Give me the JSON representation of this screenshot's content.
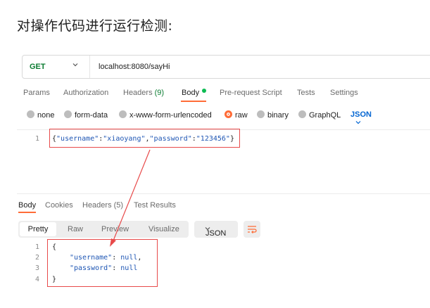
{
  "heading": "对操作代码进行运行检测:",
  "request": {
    "method": "GET",
    "url": "localhost:8080/sayHi"
  },
  "request_tabs": {
    "params": "Params",
    "authorization": "Authorization",
    "headers": "Headers",
    "headers_count": "(9)",
    "body": "Body",
    "pre_request": "Pre-request Script",
    "tests": "Tests",
    "settings": "Settings"
  },
  "body_types": {
    "none": "none",
    "form_data": "form-data",
    "urlencoded": "x-www-form-urlencoded",
    "raw": "raw",
    "binary": "binary",
    "graphql": "GraphQL",
    "format": "JSON"
  },
  "request_body": {
    "line_no": "1",
    "open": "{",
    "k1": "\"username\"",
    "colon1": ":",
    "v1": "\"xiaoyang\"",
    "comma": ",",
    "k2": "\"password\"",
    "colon2": ":",
    "v2": "\"123456\"",
    "close": "}"
  },
  "response_tabs": {
    "body": "Body",
    "cookies": "Cookies",
    "headers": "Headers (5)",
    "test_results": "Test Results"
  },
  "view_modes": {
    "pretty": "Pretty",
    "raw": "Raw",
    "preview": "Preview",
    "visualize": "Visualize",
    "format": "JSON"
  },
  "response_body": {
    "ln1": "1",
    "ln2": "2",
    "ln3": "3",
    "ln4": "4",
    "open": "{",
    "k1": "\"username\"",
    "colon1": ":",
    "v1": "null",
    "comma": ",",
    "k2": "\"password\"",
    "colon2": ":",
    "v2": "null",
    "close": "}"
  },
  "colors": {
    "accent": "#ff6c37",
    "annotation": "#e84a4a",
    "method": "#0c7c32",
    "json_link": "#0265d2"
  }
}
